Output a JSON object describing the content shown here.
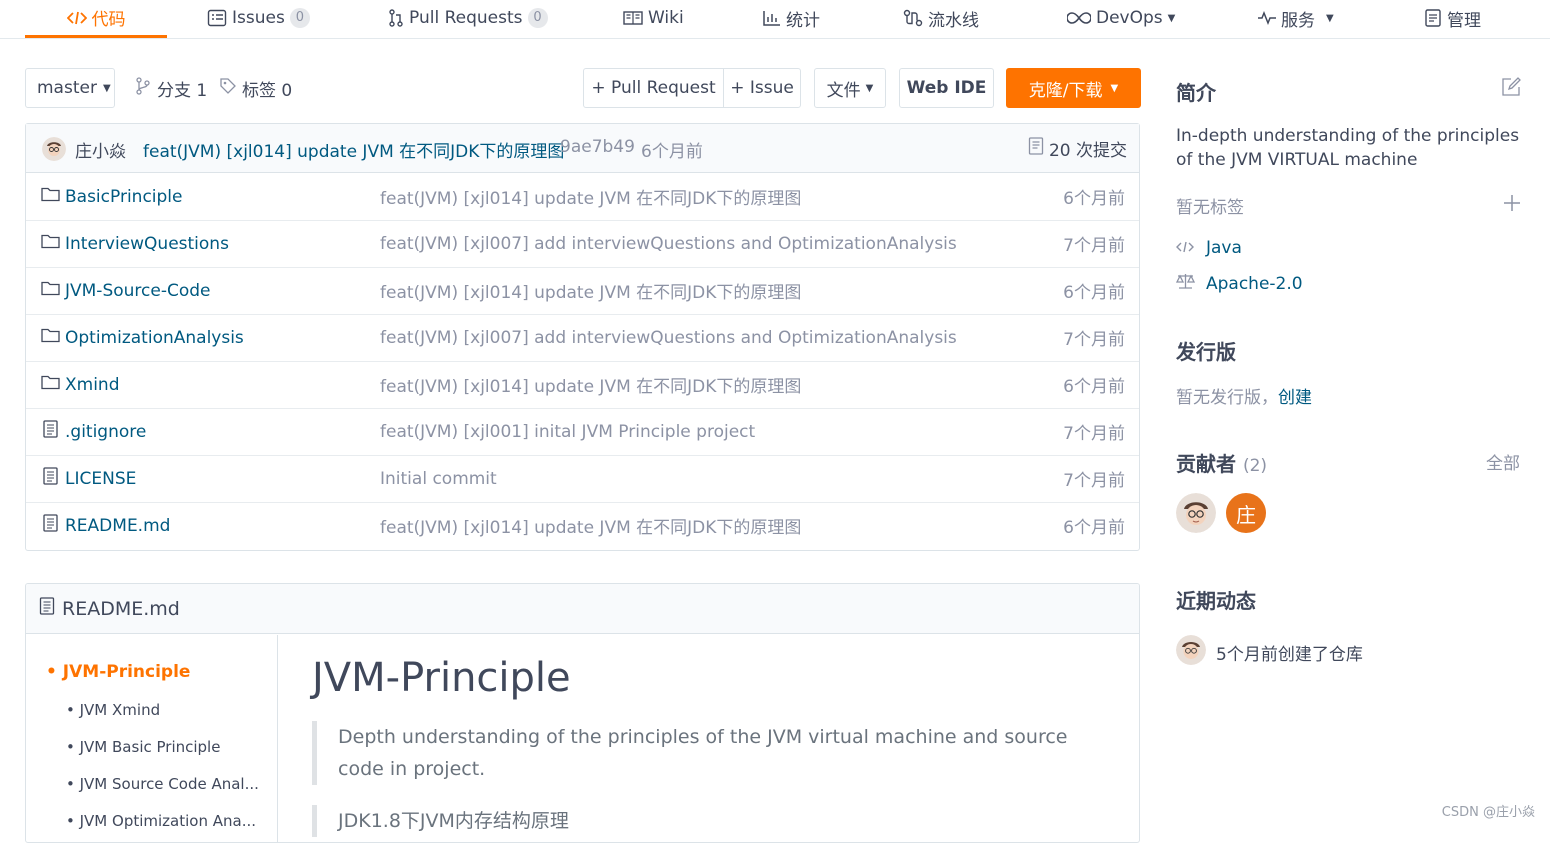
{
  "nav": {
    "code": "代码",
    "issues": "Issues",
    "issues_count": "0",
    "pull_requests": "Pull Requests",
    "pull_requests_count": "0",
    "wiki": "Wiki",
    "stats": "统计",
    "pipeline": "流水线",
    "devops": "DevOps",
    "services": "服务",
    "manage": "管理"
  },
  "branch_bar": {
    "branch": "master",
    "branches": "分支 1",
    "tags": "标签 0",
    "pull_request_btn": "+ Pull Request",
    "issue_btn": "+ Issue",
    "file_btn": "文件",
    "web_ide": "Web IDE",
    "clone_btn": "克隆/下载"
  },
  "latest_commit": {
    "author": "庄小焱",
    "message": "feat(JVM) [xjl014] update JVM 在不同JDK下的原理图",
    "hash": "9ae7b49",
    "time": "6个月前",
    "commit_count": "20 次提交"
  },
  "files": [
    {
      "name": "BasicPrinciple",
      "type": "folder",
      "message": "feat(JVM) [xjl014] update JVM 在不同JDK下的原理图",
      "time": "6个月前"
    },
    {
      "name": "InterviewQuestions",
      "type": "folder",
      "message": "feat(JVM) [xjl007] add interviewQuestions and OptimizationAnalysis",
      "time": "7个月前"
    },
    {
      "name": "JVM-Source-Code",
      "type": "folder",
      "message": "feat(JVM) [xjl014] update JVM 在不同JDK下的原理图",
      "time": "6个月前"
    },
    {
      "name": "OptimizationAnalysis",
      "type": "folder",
      "message": "feat(JVM) [xjl007] add interviewQuestions and OptimizationAnalysis",
      "time": "7个月前"
    },
    {
      "name": "Xmind",
      "type": "folder",
      "message": "feat(JVM) [xjl014] update JVM 在不同JDK下的原理图",
      "time": "6个月前"
    },
    {
      "name": ".gitignore",
      "type": "file",
      "message": "feat(JVM) [xjl001] inital JVM Principle project",
      "time": "7个月前"
    },
    {
      "name": "LICENSE",
      "type": "file",
      "message": "Initial commit",
      "time": "7个月前"
    },
    {
      "name": "README.md",
      "type": "file",
      "message": "feat(JVM) [xjl014] update JVM 在不同JDK下的原理图",
      "time": "6个月前"
    }
  ],
  "readme": {
    "header": "README.md",
    "toc": {
      "top": "JVM-Principle",
      "items": [
        "JVM Xmind",
        "JVM Basic Principle",
        "JVM Source Code Anal...",
        "JVM Optimization Ana..."
      ]
    },
    "title": "JVM-Principle",
    "quote": "Depth understanding of the principles of the JVM virtual machine and source code in project.",
    "quote2": "JDK1.8下JVM内存结构原理"
  },
  "sidebar": {
    "intro_title": "简介",
    "description": "In-depth understanding of the principles of the JVM VIRTUAL machine",
    "no_tags": "暂无标签",
    "language": "Java",
    "license": "Apache-2.0",
    "release_title": "发行版",
    "no_release": "暂无发行版，",
    "create": "创建",
    "contributors_title": "贡献者",
    "contributors_count": "(2)",
    "all": "全部",
    "contributor_initial": "庄",
    "activity_title": "近期动态",
    "activity_text": "5个月前创建了仓库"
  },
  "watermark": "CSDN @庄小焱",
  "colors": {
    "accent": "#fe7300",
    "link": "#005980",
    "muted": "#8c92a4",
    "text": "#40485b",
    "border": "#dce3e8"
  }
}
